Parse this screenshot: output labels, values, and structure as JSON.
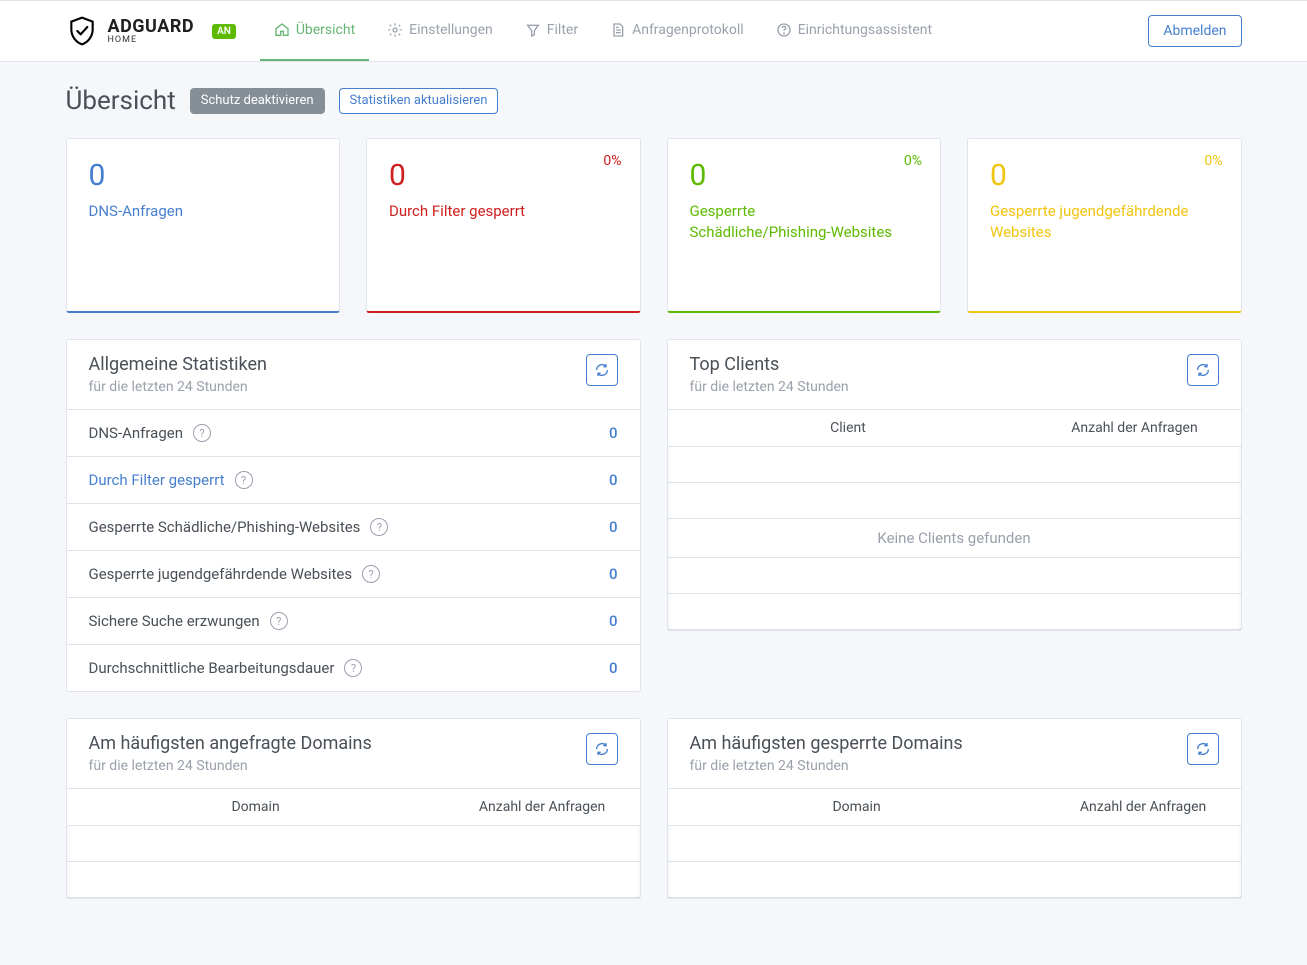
{
  "brand": {
    "main": "ADGUARD",
    "sub": "HOME",
    "badge": "AN"
  },
  "nav": {
    "dashboard": "Übersicht",
    "settings": "Einstellungen",
    "filters": "Filter",
    "querylog": "Anfragenprotokoll",
    "setup": "Einrichtungsassistent",
    "logout": "Abmelden"
  },
  "page": {
    "title": "Übersicht",
    "disable_btn": "Schutz deaktivieren",
    "refresh_stats_btn": "Statistiken aktualisieren"
  },
  "stat_cards": {
    "dns": {
      "value": "0",
      "label": "DNS-Anfragen"
    },
    "blocked": {
      "value": "0",
      "label": "Durch Filter gesperrt",
      "pct": "0%"
    },
    "malware": {
      "value": "0",
      "label": "Gesperrte Schädliche/Phishing-Websites",
      "pct": "0%"
    },
    "adult": {
      "value": "0",
      "label": "Gesperrte jugendgefährdende Websites",
      "pct": "0%"
    }
  },
  "general_stats": {
    "title": "Allgemeine Statistiken",
    "subtitle": "für die letzten 24 Stunden",
    "rows": [
      {
        "label": "DNS-Anfragen",
        "value": "0",
        "link": false
      },
      {
        "label": "Durch Filter gesperrt",
        "value": "0",
        "link": true
      },
      {
        "label": "Gesperrte Schädliche/Phishing-Websites",
        "value": "0",
        "link": false
      },
      {
        "label": "Gesperrte jugendgefährdende Websites",
        "value": "0",
        "link": false
      },
      {
        "label": "Sichere Suche erzwungen",
        "value": "0",
        "link": false
      },
      {
        "label": "Durchschnittliche Bearbeitungsdauer",
        "value": "0",
        "link": false
      }
    ]
  },
  "top_clients": {
    "title": "Top Clients",
    "subtitle": "für die letzten 24 Stunden",
    "col_client": "Client",
    "col_count": "Anzahl der Anfragen",
    "empty": "Keine Clients gefunden"
  },
  "top_queried": {
    "title": "Am häufigsten angefragte Domains",
    "subtitle": "für die letzten 24 Stunden",
    "col_domain": "Domain",
    "col_count": "Anzahl der Anfragen"
  },
  "top_blocked": {
    "title": "Am häufigsten gesperrte Domains",
    "subtitle": "für die letzten 24 Stunden",
    "col_domain": "Domain",
    "col_count": "Anzahl der Anfragen"
  }
}
